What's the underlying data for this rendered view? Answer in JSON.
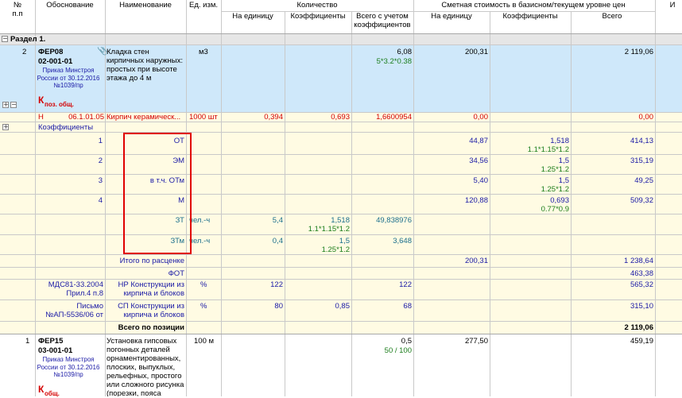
{
  "header": {
    "col_num": "№\nп.п",
    "col_basis": "Обоснование",
    "col_name": "Наименование",
    "col_unit": "Ед. изм.",
    "col_quantity": "Количество",
    "col_qty_per_unit": "На единицу",
    "col_qty_coef": "Коэффициенты",
    "col_qty_total": "Всего с учетом коэффициентов",
    "col_cost": "Сметная стоимость в базисном/текущем уровне цен",
    "col_cost_per_unit": "На единицу",
    "col_cost_coef": "Коэффициенты",
    "col_cost_total": "Всего",
    "col_extra": "И"
  },
  "section": {
    "toggle": "−",
    "title": "Раздел 1."
  },
  "item1": {
    "num": "2",
    "code": "ФЕР08",
    "code2": "02-001-01",
    "order": "Приказ Минстроя России от 30.12.2016 №1039/пр",
    "k_letter": "К",
    "k_sub": "поз. общ.",
    "name": "Кладка стен кирпичных наружных: простых при высоте этажа до 4 м",
    "unit": "м3",
    "qty_total": "6,08",
    "qty_formula": "5*3.2*0.38",
    "cost_per_unit": "200,31",
    "cost_total": "2 119,06"
  },
  "material": {
    "type": "Н",
    "code": "06.1.01.05",
    "name": "Кирпич керамическ...",
    "unit": "1000 шт",
    "qty_per_unit": "0,394",
    "qty_coef": "0,693",
    "qty_total": "1,6600954",
    "cost_per_unit": "0,00",
    "cost_total": "0,00"
  },
  "coefficients_label": "Коэффициенты",
  "rows": [
    {
      "n": "1",
      "name": "ОТ",
      "cost_per_unit": "44,87",
      "coef": "1,518",
      "formula": "1.1*1.15*1.2",
      "total": "414,13"
    },
    {
      "n": "2",
      "name": "ЭМ",
      "cost_per_unit": "34,56",
      "coef": "1,5",
      "formula": "1.25*1.2",
      "total": "315,19"
    },
    {
      "n": "3",
      "name": "в т.ч. ОТм",
      "cost_per_unit": "5,40",
      "coef": "1,5",
      "formula": "1.25*1.2",
      "total": "49,25"
    },
    {
      "n": "4",
      "name": "М",
      "cost_per_unit": "120,88",
      "coef": "0,693",
      "formula": "0.77*0.9",
      "total": "509,32"
    }
  ],
  "labor": [
    {
      "name": "ЗТ",
      "unit": "чел.-ч",
      "per_unit": "5,4",
      "coef": "1,518",
      "formula": "1.1*1.15*1.2",
      "total": "49,838976"
    },
    {
      "name": "ЗТм",
      "unit": "чел.-ч",
      "per_unit": "0,4",
      "coef": "1,5",
      "formula": "1.25*1.2",
      "total": "3,648"
    }
  ],
  "totals": {
    "itogo_label": "Итого по расценке",
    "itogo_cost": "200,31",
    "itogo_total": "1 238,64",
    "fot_label": "ФОТ",
    "fot_total": "463,38",
    "np_basis": "МДС81-33.2004 Прил.4 п.8",
    "np_name": "НР Конструкции из кирпича и блоков",
    "np_unit": "%",
    "np_val": "122",
    "np_total_q": "122",
    "np_total": "565,32",
    "sp_basis": "Письмо №АП-5536/06 от",
    "sp_name": "СП Конструкции из кирпича и блоков",
    "sp_unit": "%",
    "sp_val": "80",
    "sp_coef": "0,85",
    "sp_total_q": "68",
    "sp_total": "315,10",
    "position_label": "Всего по позиции",
    "position_total": "2 119,06"
  },
  "item2": {
    "num": "1",
    "code": "ФЕР15",
    "code2": "03-001-01",
    "order": "Приказ Минстроя России от 30.12.2016 №1039/пр",
    "k_letter": "К",
    "k_sub": "общ.",
    "name": "Установка гипсовых погонных деталей орнаментированных, плоских, выпуклых, рельефных, простого или сложного рисунка (порезки, пояса",
    "unit": "100 м",
    "qty_total": "0,5",
    "qty_formula": "50 / 100",
    "cost_per_unit": "277,50",
    "cost_total": "459,19"
  },
  "colors": {
    "header_bg": "#ffffff",
    "selected_row": "#cfe8fa",
    "section_bg": "#e6e6e6",
    "yellow_row": "#fffbe3",
    "highlight": "#e00000"
  }
}
